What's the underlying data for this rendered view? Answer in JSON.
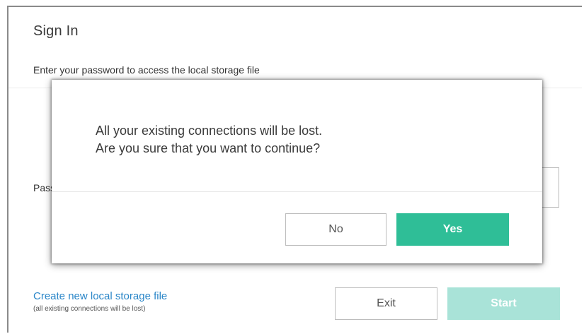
{
  "signin": {
    "title": "Sign In",
    "subtitle": "Enter your password to access the local storage file",
    "password_label": "Password",
    "password_value": "",
    "create_link": "Create new local storage file",
    "create_note": "(all existing connections will be lost)",
    "exit_label": "Exit",
    "start_label": "Start"
  },
  "dialog": {
    "line1": "All your existing connections will be lost.",
    "line2": "Are you sure that you want to continue?",
    "no_label": "No",
    "yes_label": "Yes"
  },
  "colors": {
    "accent": "#2fbe97",
    "accent_disabled": "#a9e3d8",
    "link": "#2a86c8"
  }
}
